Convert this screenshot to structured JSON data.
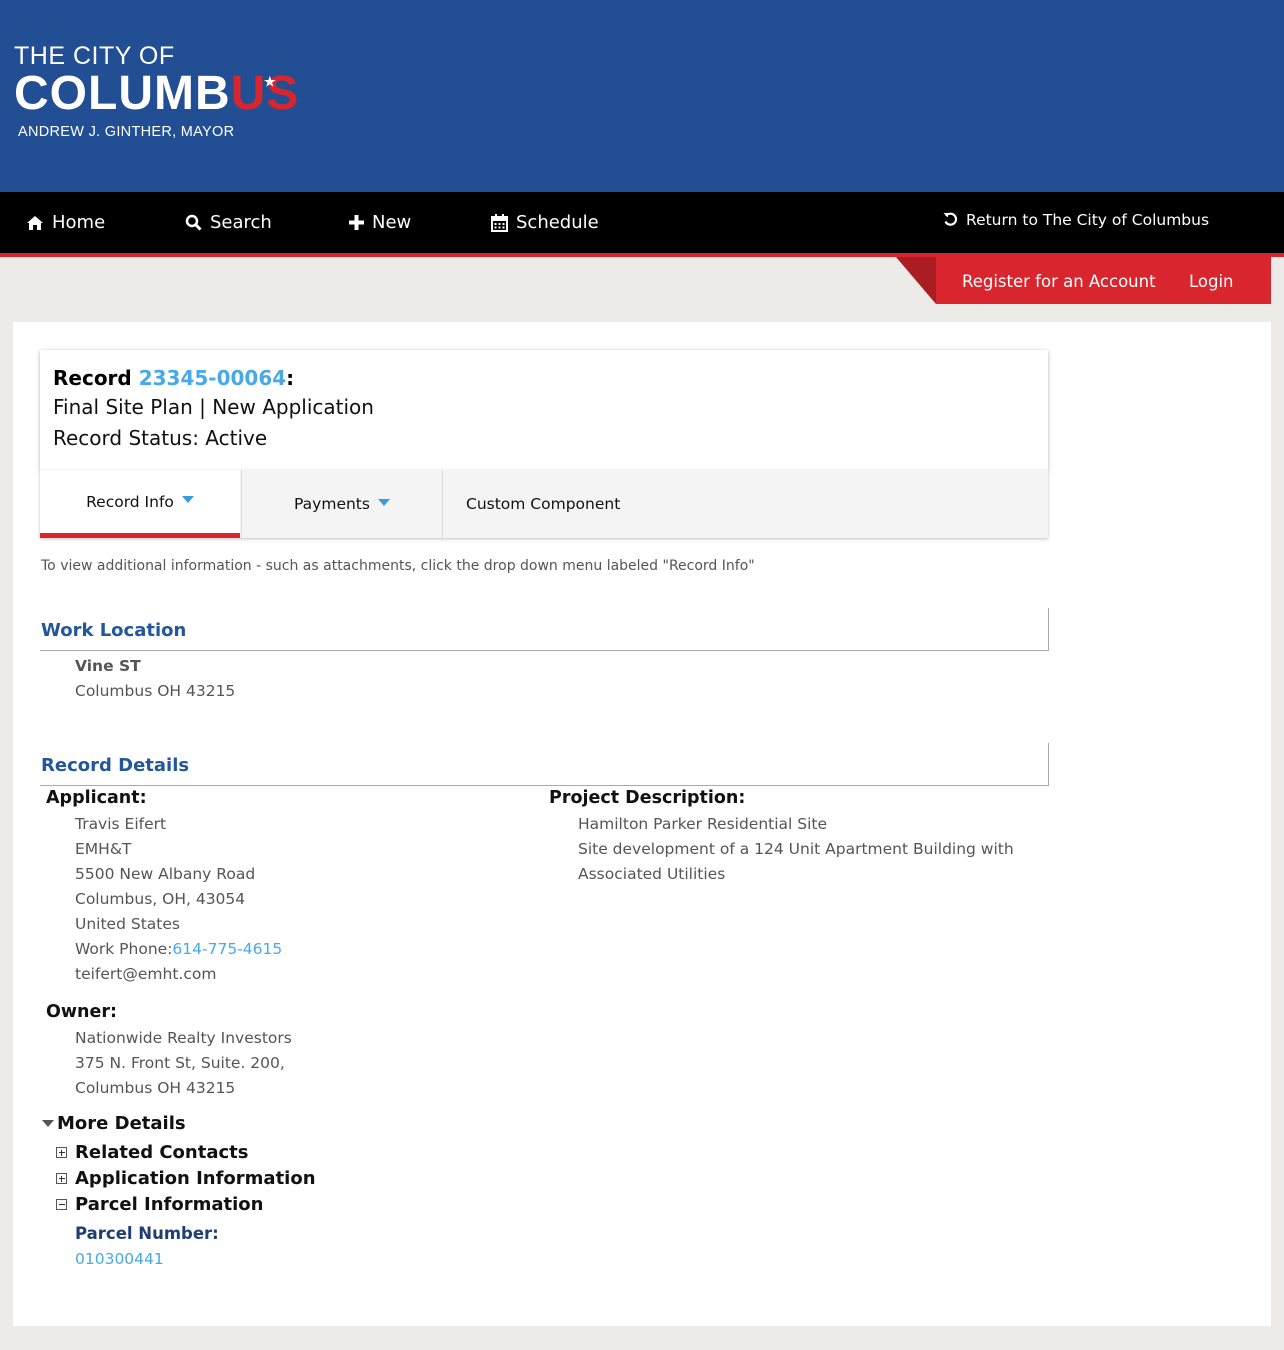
{
  "logo": {
    "line1": "THE CITY OF",
    "line2_main": "COLUMB",
    "line2_red": "US",
    "line3": "ANDREW J. GINTHER, MAYOR"
  },
  "nav": {
    "home": "Home",
    "search": "Search",
    "new": "New",
    "schedule": "Schedule",
    "return": "Return to The City of Columbus"
  },
  "account": {
    "register": "Register for an Account",
    "login": "Login"
  },
  "record": {
    "prefix": "Record ",
    "number": "23345-00064",
    "suffix": ":",
    "type": "Final Site Plan | New Application",
    "status": "Record Status: Active"
  },
  "tabs": {
    "record_info": "Record Info",
    "payments": "Payments",
    "custom": "Custom Component"
  },
  "info_text": "To view additional information - such as attachments, click the drop down menu labeled \"Record Info\"",
  "work_location": {
    "title": "Work Location",
    "street": "Vine ST",
    "city": "Columbus OH 43215"
  },
  "record_details": {
    "title": "Record Details",
    "applicant_label": "Applicant:",
    "applicant": {
      "name": "Travis Eifert",
      "company": "EMH&T",
      "address": "5500 New Albany Road",
      "city": "Columbus, OH, 43054",
      "country": "United States",
      "phone_label": "Work Phone:",
      "phone": "614-775-4615",
      "email": "teifert@emht.com"
    },
    "project_label": "Project Description:",
    "project": {
      "line1": "Hamilton Parker Residential Site",
      "line2": "Site development of a 124 Unit Apartment Building with",
      "line3": "Associated Utilities"
    },
    "owner_label": "Owner:",
    "owner": {
      "name": "Nationwide Realty Investors",
      "address": "375 N. Front St, Suite. 200,",
      "city": "Columbus OH 43215"
    }
  },
  "more_details": {
    "title": "More Details",
    "related_contacts": "Related Contacts",
    "application_information": "Application Information",
    "parcel_information": "Parcel Information",
    "parcel_number_label": "Parcel Number:",
    "parcel_number": "010300441"
  },
  "colors": {
    "header_blue": "#224e94",
    "brand_red": "#d9262e",
    "link_blue": "#47a9e8",
    "section_blue": "#235799"
  }
}
